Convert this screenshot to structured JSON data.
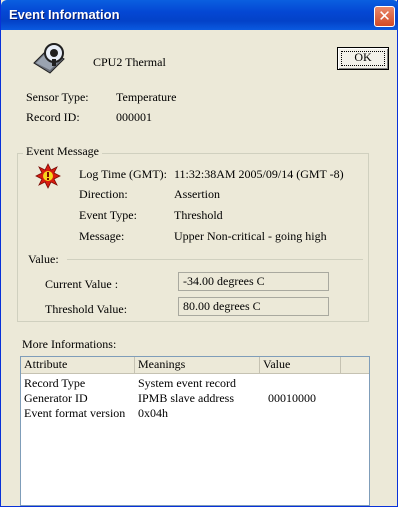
{
  "window": {
    "title": "Event Information",
    "close_symbol": "✕"
  },
  "sensor": {
    "name": "CPU2 Thermal",
    "icon": "thermal-sensor-icon"
  },
  "ok_button": "OK",
  "info": {
    "sensor_type_label": "Sensor Type:",
    "sensor_type_value": "Temperature",
    "record_id_label": "Record ID:",
    "record_id_value": "000001"
  },
  "event_message": {
    "legend": "Event Message",
    "icon": "alert-burst-icon",
    "rows": [
      {
        "label": "Log Time (GMT):",
        "value": "11:32:38AM 2005/09/14 (GMT -8)"
      },
      {
        "label": "Direction:",
        "value": "Assertion"
      },
      {
        "label": "Event Type:",
        "value": "Threshold"
      },
      {
        "label": "Message:",
        "value": "Upper Non-critical - going high"
      }
    ],
    "value_label": "Value:",
    "current_value_label": "Current Value :",
    "current_value": "-34.00 degrees C",
    "threshold_value_label": "Threshold Value:",
    "threshold_value": "80.00 degrees C"
  },
  "more": {
    "label": "More Informations:",
    "columns": [
      "Attribute",
      "Meanings",
      "Value"
    ],
    "rows": [
      [
        "Record Type",
        "System event record",
        ""
      ],
      [
        "Generator ID",
        "IPMB slave address",
        "00010000"
      ],
      [
        "Event format version",
        "0x04h",
        ""
      ]
    ]
  },
  "colors": {
    "titlebar": "#0447d4",
    "window_bg": "#ece9d8",
    "alert_red": "#d81c10",
    "alert_yellow": "#f7d51c"
  }
}
